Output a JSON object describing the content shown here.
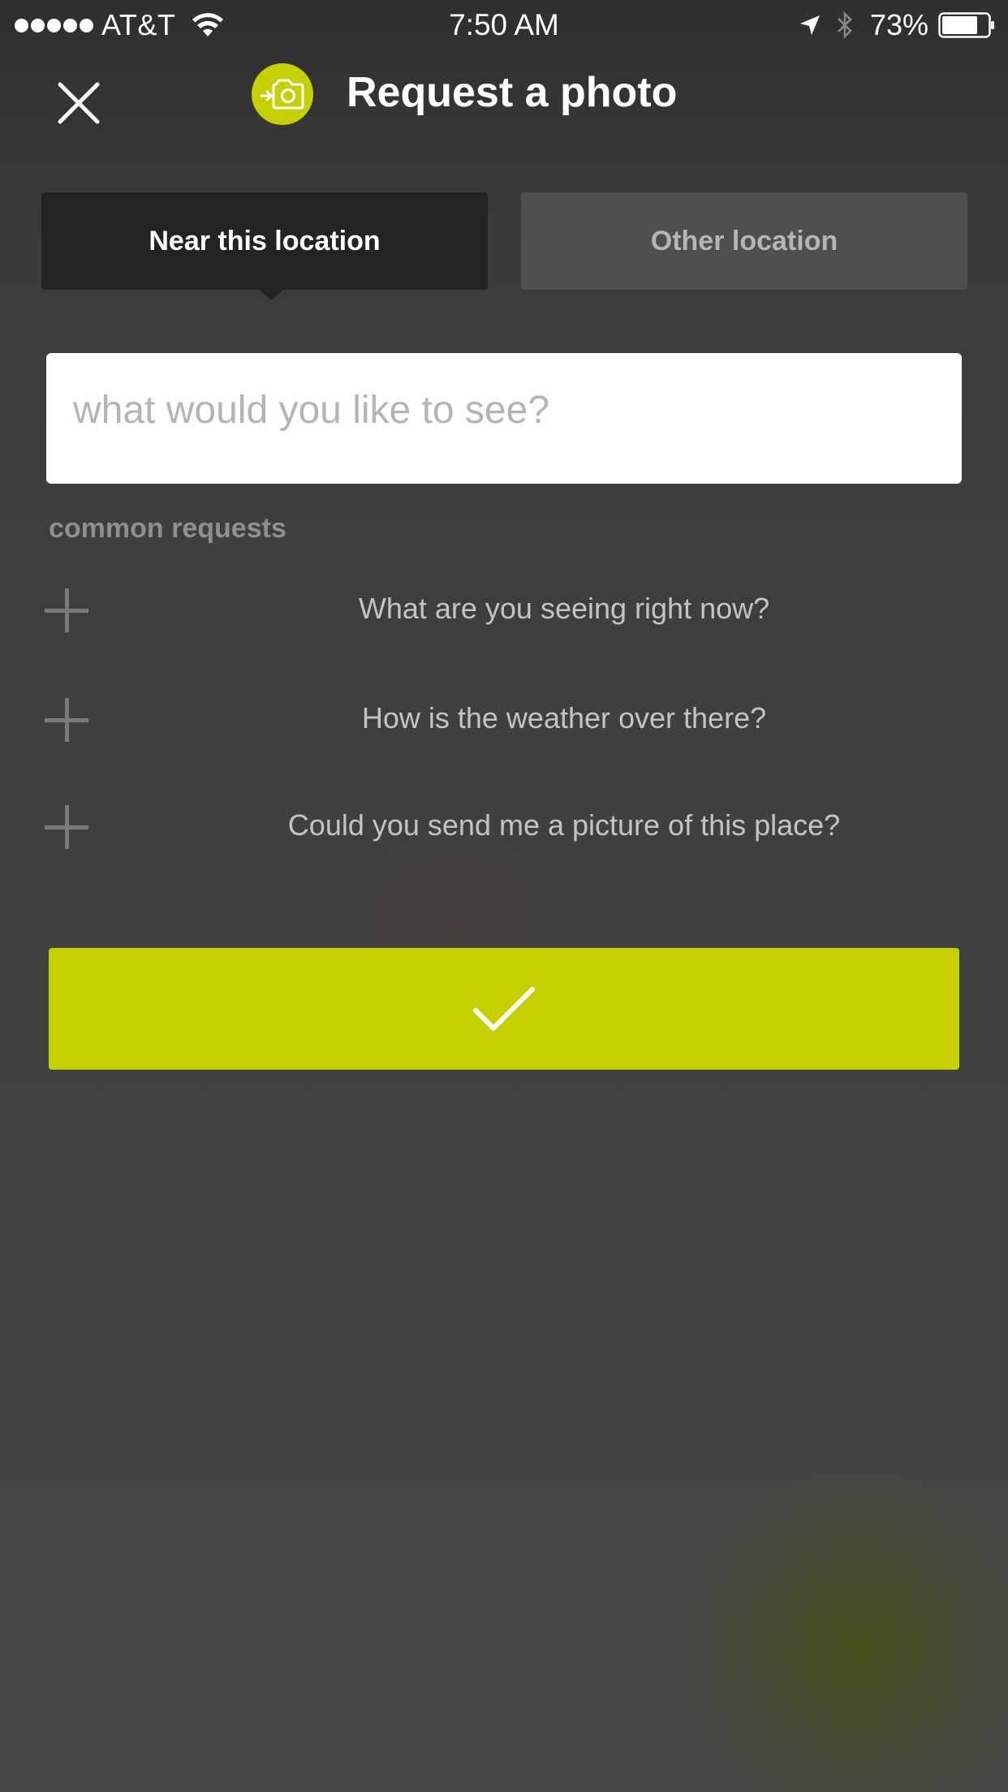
{
  "status_bar": {
    "carrier": "AT&T",
    "time": "7:50 AM",
    "battery": "73%"
  },
  "header": {
    "title": "Request a photo",
    "app_icon": "camera-arrow-icon"
  },
  "tabs": [
    {
      "label": "Near this location",
      "active": true
    },
    {
      "label": "Other location",
      "active": false
    }
  ],
  "request_input": {
    "value": "",
    "placeholder": "what would you like to see?"
  },
  "common_requests": {
    "label": "common requests",
    "items": [
      {
        "text": "What are you seeing right now?"
      },
      {
        "text": "How is the weather over there?"
      },
      {
        "text": "Could you send me a picture of this place?"
      }
    ]
  },
  "confirm": {
    "icon": "checkmark-icon"
  },
  "colors": {
    "accent": "#c5d000",
    "background": "#404040",
    "active_tab": "#232323",
    "inactive_tab": "#4f4f4f"
  }
}
